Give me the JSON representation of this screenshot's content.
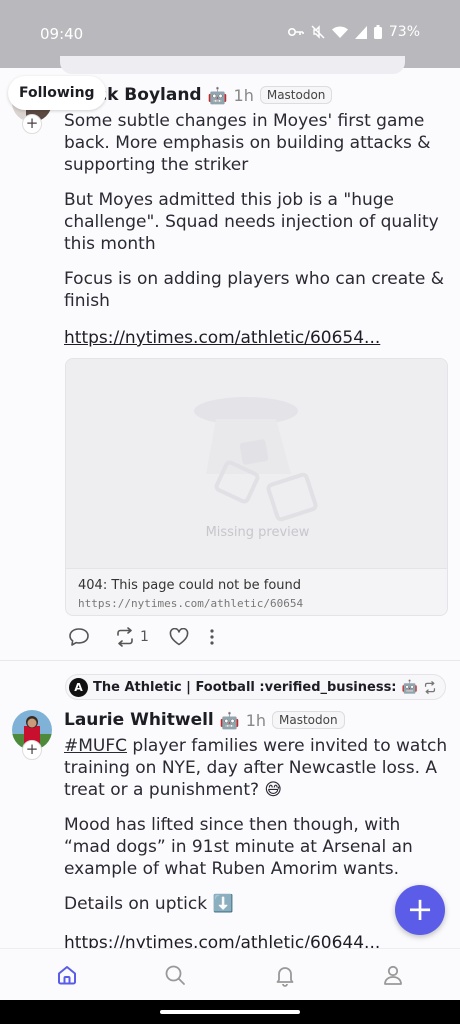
{
  "status_bar": {
    "time": "09:40",
    "battery": "73%",
    "icons": [
      "vpn-key-icon",
      "mute-icon",
      "wifi-icon",
      "signal-icon",
      "battery-icon"
    ]
  },
  "feed": {
    "filter_label": "Following"
  },
  "post1": {
    "author": "ck Boyland",
    "bot_icon": "🤖",
    "time": "1h",
    "instance": "Mastodon",
    "paragraphs": [
      "Some subtle changes in Moyes' first game back. More emphasis on building attacks & supporting the striker",
      "But Moyes admitted this job is a \"huge challenge\". Squad needs injection of quality this month",
      "Focus is on adding players who can create & finish"
    ],
    "link": "https://nytimes.com/athletic/60654...",
    "preview": {
      "image_label": "Missing preview",
      "title": "404: This page could not be found",
      "url": "https://nytimes.com/athletic/60654"
    },
    "boost_count": "1"
  },
  "post2": {
    "boosted_by": "The Athletic | Football :verified_business:",
    "boosted_logo": "A",
    "author": "Laurie Whitwell",
    "bot_icon": "🤖",
    "time": "1h",
    "instance": "Mastodon",
    "hashtag": "#MUFC",
    "paragraph1_rest": " player families were invited to watch training on NYE, day after Newcastle loss. A treat or a punishment? 😅",
    "paragraph2": "Mood has lifted since then though, with “mad dogs” in 91st minute at Arsenal an example of what Ruben Amorim wants.",
    "paragraph3": "Details on uptick ⬇️",
    "link": "https://nytimes.com/athletic/60644..."
  },
  "fab_label": "+",
  "avatar_plus": "+",
  "nav": [
    "home-icon",
    "search-icon",
    "notifications-icon",
    "profile-icon"
  ],
  "colors": {
    "accent": "#5b5ce8",
    "status_bar": "#b9b9bd"
  }
}
